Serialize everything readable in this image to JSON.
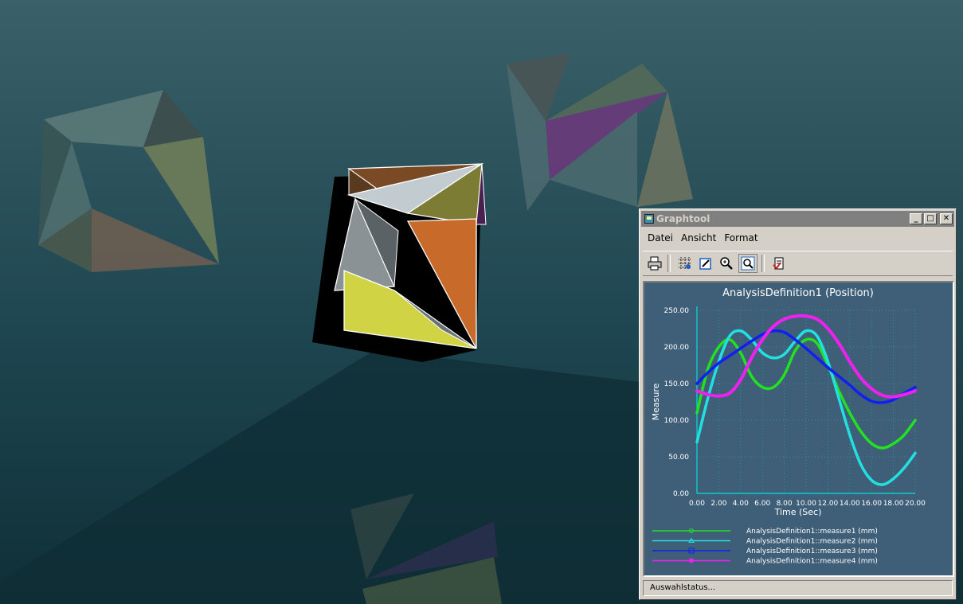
{
  "window": {
    "title": "Graphtool",
    "minimize_label": "_",
    "maximize_label": "□",
    "close_label": "✕"
  },
  "menu": {
    "items": [
      "Datei",
      "Ansicht",
      "Format"
    ]
  },
  "toolbar": {
    "icons": [
      "print-icon",
      "grid-icon",
      "edit-icon",
      "zoom-in-icon",
      "zoom-fit-icon",
      "export-icon"
    ]
  },
  "statusbar": {
    "text": "Auswahlstatus..."
  },
  "colors": {
    "plot_bg": "#3f5f78",
    "axis": "#00e0e0",
    "measure1": "#22e022",
    "measure2": "#22e0e0",
    "measure3": "#1020f0",
    "measure4": "#f020f0"
  },
  "chart_data": {
    "type": "line",
    "title": "AnalysisDefinition1 (Position)",
    "xlabel": "Time (Sec)",
    "ylabel": "Measure",
    "xlim": [
      0,
      20
    ],
    "ylim": [
      0,
      250
    ],
    "grid": true,
    "legend_position": "bottom",
    "x_ticks": [
      "0.00",
      "2.00",
      "4.00",
      "6.00",
      "8.00",
      "10.00",
      "12.00",
      "14.00",
      "16.00",
      "18.00",
      "20.00"
    ],
    "y_ticks": [
      "0.00",
      "50.00",
      "100.00",
      "150.00",
      "200.00",
      "250.00"
    ],
    "x": [
      0,
      1,
      2,
      3,
      4,
      5,
      6,
      7,
      8,
      9,
      10,
      11,
      12,
      13,
      14,
      15,
      16,
      17,
      18,
      19,
      20
    ],
    "series": [
      {
        "name": "AnalysisDefinition1::measure1 (mm)",
        "color": "#22e022",
        "values": [
          110,
          170,
          200,
          210,
          192,
          160,
          145,
          145,
          162,
          195,
          210,
          205,
          175,
          140,
          110,
          85,
          68,
          62,
          68,
          80,
          100
        ]
      },
      {
        "name": "AnalysisDefinition1::measure2 (mm)",
        "color": "#22e0e0",
        "values": [
          70,
          130,
          180,
          215,
          222,
          210,
          192,
          185,
          190,
          208,
          222,
          215,
          180,
          130,
          80,
          40,
          18,
          12,
          20,
          35,
          55
        ]
      },
      {
        "name": "AnalysisDefinition1::measure3 (mm)",
        "color": "#1020f0",
        "values": [
          150,
          165,
          178,
          188,
          198,
          208,
          217,
          222,
          220,
          210,
          198,
          185,
          172,
          160,
          148,
          135,
          126,
          124,
          128,
          137,
          145
        ]
      },
      {
        "name": "AnalysisDefinition1::measure4 (mm)",
        "color": "#f020f0",
        "values": [
          140,
          135,
          133,
          137,
          155,
          185,
          210,
          228,
          238,
          242,
          242,
          238,
          225,
          205,
          180,
          158,
          143,
          134,
          132,
          135,
          140
        ]
      }
    ]
  }
}
